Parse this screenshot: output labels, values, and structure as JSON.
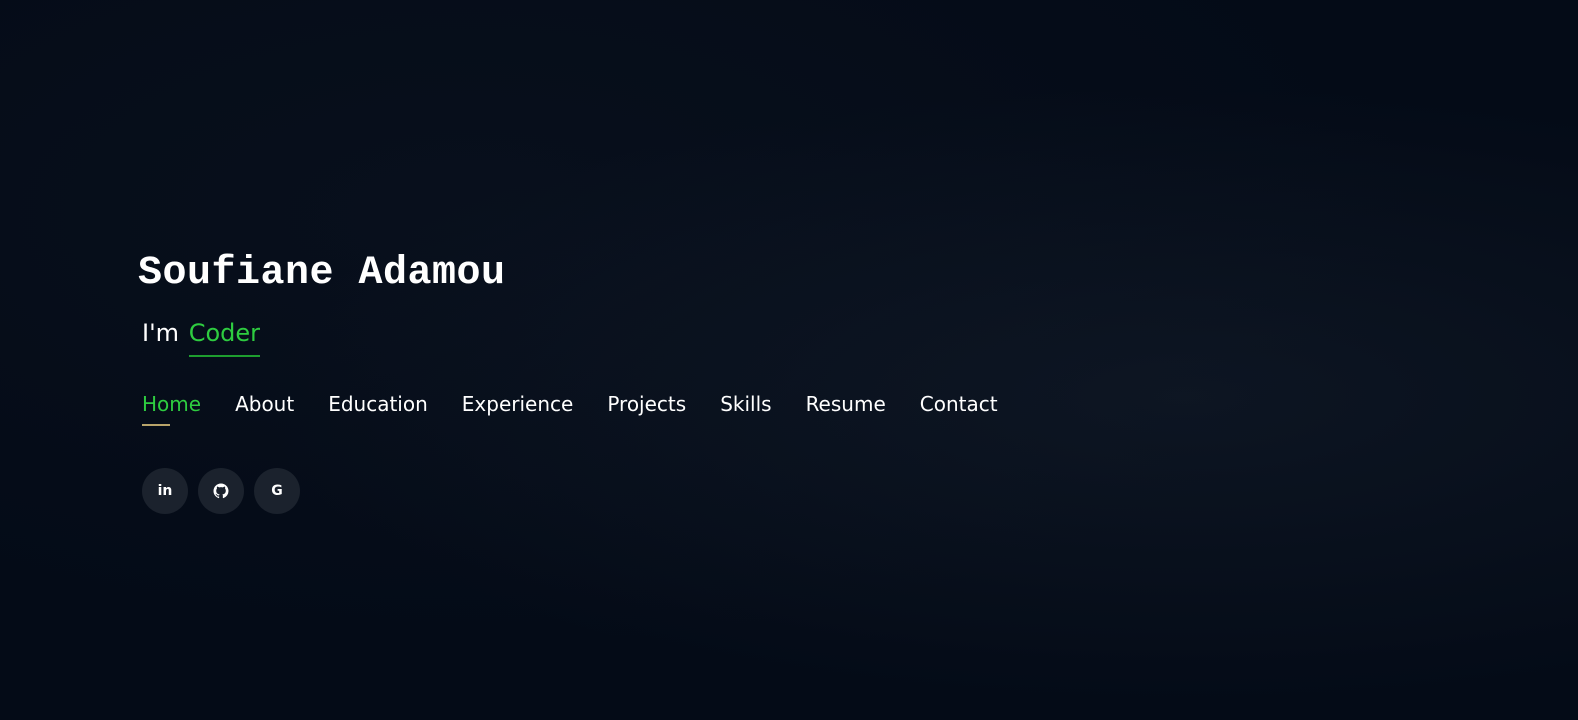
{
  "hero": {
    "name": "Soufiane Adamou",
    "tagline_prefix": "I'm ",
    "tagline_role": "Coder"
  },
  "nav": {
    "items": [
      {
        "label": "Home",
        "active": true
      },
      {
        "label": "About",
        "active": false
      },
      {
        "label": "Education",
        "active": false
      },
      {
        "label": "Experience",
        "active": false
      },
      {
        "label": "Projects",
        "active": false
      },
      {
        "label": "Skills",
        "active": false
      },
      {
        "label": "Resume",
        "active": false
      },
      {
        "label": "Contact",
        "active": false
      }
    ]
  },
  "social": {
    "links": [
      {
        "icon": "linkedin-icon",
        "glyph": "in"
      },
      {
        "icon": "github-icon",
        "glyph": ""
      },
      {
        "icon": "google-icon",
        "glyph": "G"
      }
    ]
  },
  "colors": {
    "background": "#040b17",
    "accent": "#2ecc40",
    "underline": "#b8a46a",
    "social_bg": "#1b222d"
  }
}
